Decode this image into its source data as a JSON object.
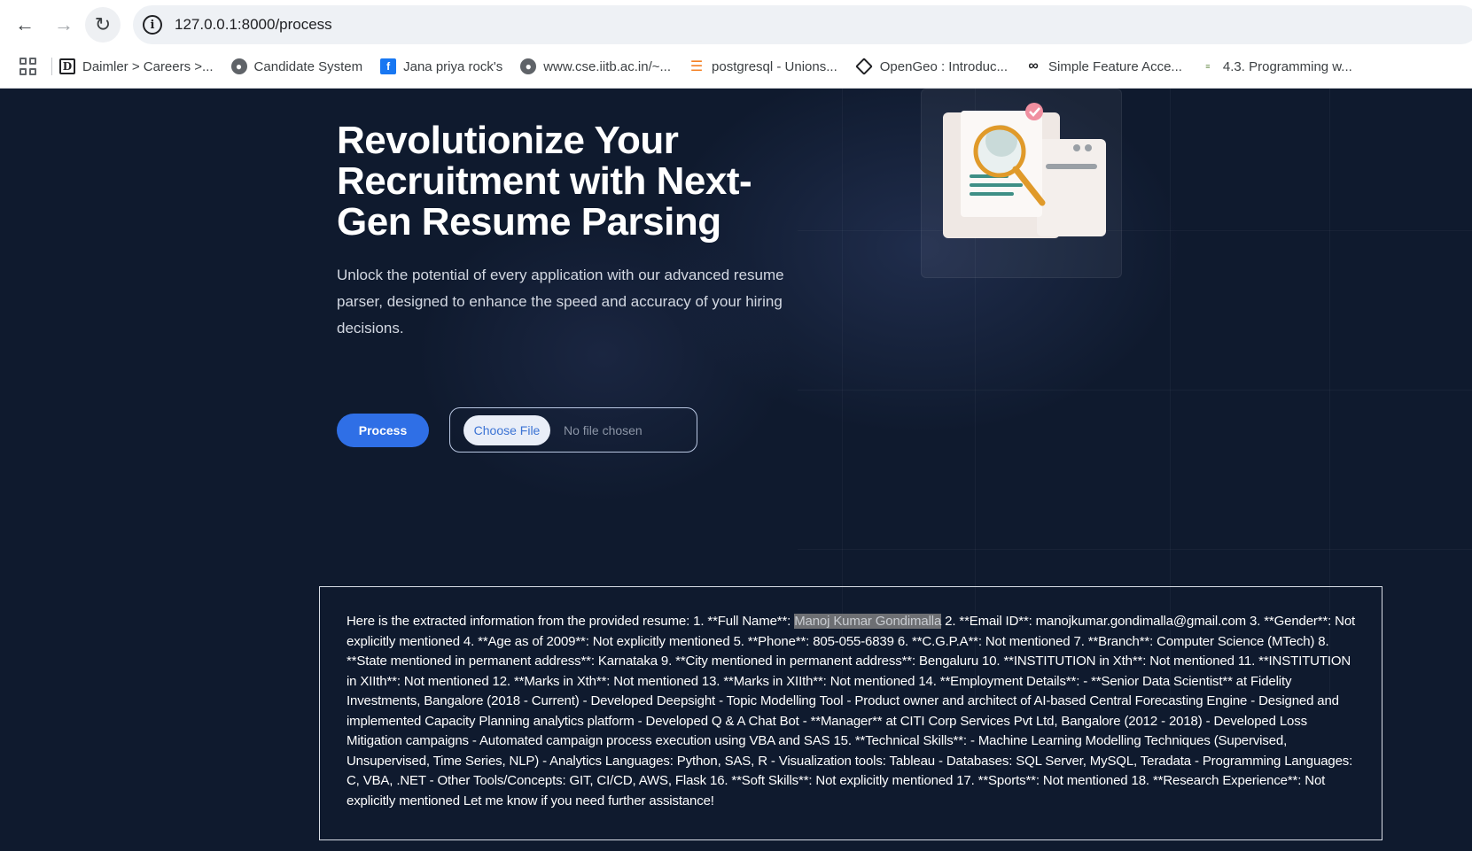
{
  "browser": {
    "url": "127.0.0.1:8000/process",
    "bookmarks": [
      {
        "label": "Daimler > Careers >...",
        "icon": "daimler-icon"
      },
      {
        "label": "Candidate System",
        "icon": "globe-icon"
      },
      {
        "label": "Jana priya rock's",
        "icon": "facebook-icon"
      },
      {
        "label": "www.cse.iitb.ac.in/~...",
        "icon": "globe-icon"
      },
      {
        "label": "postgresql - Unions...",
        "icon": "stackoverflow-icon"
      },
      {
        "label": "OpenGeo : Introduc...",
        "icon": "opengeo-icon"
      },
      {
        "label": "Simple Feature Acce...",
        "icon": "ogc-icon"
      },
      {
        "label": "4.3. Programming w...",
        "icon": "openbm-icon"
      }
    ]
  },
  "hero": {
    "title": "Revolutionize Your Recruitment with Next-Gen Resume Parsing",
    "subtitle": "Unlock the potential of every application with our advanced resume parser, designed to enhance the speed and accuracy of your hiring decisions."
  },
  "form": {
    "process_label": "Process",
    "choose_file_label": "Choose File",
    "file_status": "No file chosen"
  },
  "result": {
    "before_highlight": "Here is the extracted information from the provided resume: 1. **Full Name**: ",
    "highlight": "Manoj Kumar Gondimalla",
    "after_highlight": " 2. **Email ID**: manojkumar.gondimalla@gmail.com 3. **Gender**: Not explicitly mentioned 4. **Age as of 2009**: Not explicitly mentioned 5. **Phone**: 805-055-6839 6. **C.G.P.A**: Not mentioned 7. **Branch**: Computer Science (MTech) 8. **State mentioned in permanent address**: Karnataka 9. **City mentioned in permanent address**: Bengaluru 10. **INSTITUTION in Xth**: Not mentioned 11. **INSTITUTION in XIIth**: Not mentioned 12. **Marks in Xth**: Not mentioned 13. **Marks in XIIth**: Not mentioned 14. **Employment Details**: - **Senior Data Scientist** at Fidelity Investments, Bangalore (2018 - Current) - Developed Deepsight - Topic Modelling Tool - Product owner and architect of AI-based Central Forecasting Engine - Designed and implemented Capacity Planning analytics platform - Developed Q & A Chat Bot - **Manager** at CITI Corp Services Pvt Ltd, Bangalore (2012 - 2018) - Developed Loss Mitigation campaigns - Automated campaign process execution using VBA and SAS 15. **Technical Skills**: - Machine Learning Modelling Techniques (Supervised, Unsupervised, Time Series, NLP) - Analytics Languages: Python, SAS, R - Visualization tools: Tableau - Databases: SQL Server, MySQL, Teradata - Programming Languages: C, VBA, .NET - Other Tools/Concepts: GIT, CI/CD, AWS, Flask 16. **Soft Skills**: Not explicitly mentioned 17. **Sports**: Not mentioned 18. **Research Experience**: Not explicitly mentioned Let me know if you need further assistance!"
  },
  "colors": {
    "page_bg": "#0f1a2e",
    "accent": "#2f6fe6",
    "highlight_bg": "#6d6f73"
  }
}
